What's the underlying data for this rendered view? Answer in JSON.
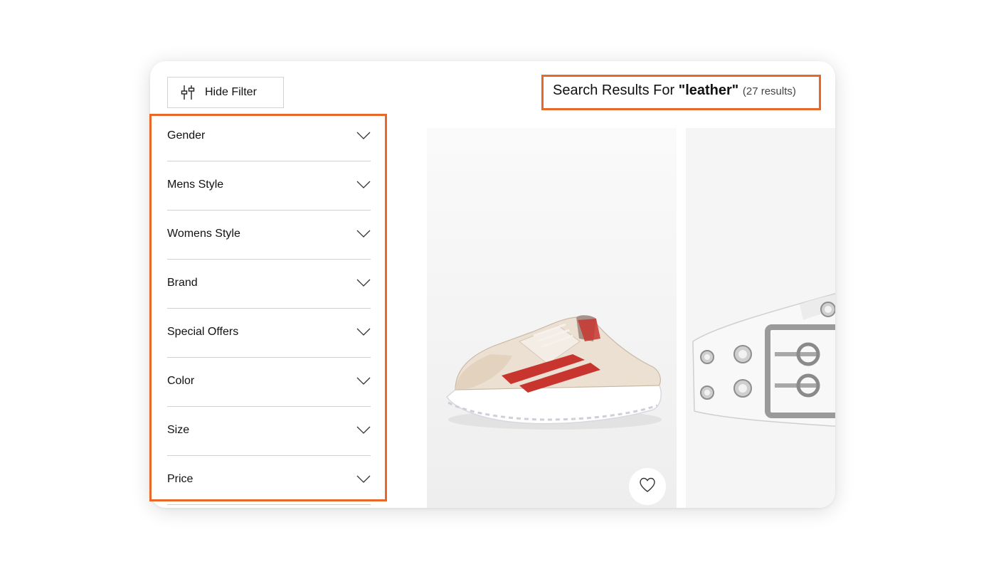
{
  "toolbar": {
    "hide_filter_label": "Hide Filter",
    "hide_filter_icon": "sliders-icon"
  },
  "filters": [
    {
      "label": "Gender"
    },
    {
      "label": "Mens Style"
    },
    {
      "label": "Womens Style"
    },
    {
      "label": "Brand"
    },
    {
      "label": "Special Offers"
    },
    {
      "label": "Color"
    },
    {
      "label": "Size"
    },
    {
      "label": "Price"
    }
  ],
  "results": {
    "prefix": "Search Results For ",
    "query": "\"leather\"",
    "count": "(27 results)"
  },
  "products": [
    {
      "kind": "sneaker",
      "favorite_icon": "heart-icon"
    },
    {
      "kind": "belt"
    }
  ],
  "colors": {
    "highlight": "#e8682a",
    "divider": "#d0d0d0",
    "sneaker_red": "#c8352f"
  }
}
